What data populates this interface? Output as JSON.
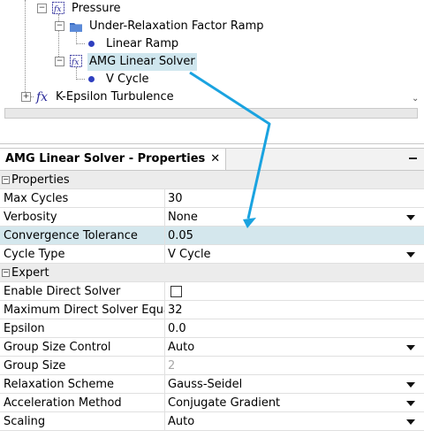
{
  "tree": {
    "nodes": [
      {
        "label": "Pressure",
        "icon": "fx-icon",
        "expander": "−"
      },
      {
        "label": "Under-Relaxation Factor Ramp",
        "icon": "folder-icon",
        "expander": "−"
      },
      {
        "label": "Linear Ramp",
        "icon": "bullet-icon"
      },
      {
        "label": "AMG Linear Solver",
        "icon": "fx-icon",
        "expander": "−",
        "selected": true
      },
      {
        "label": "V Cycle",
        "icon": "bullet-icon"
      },
      {
        "label": "K-Epsilon Turbulence",
        "icon": "fx-italic-icon",
        "expander": "+"
      }
    ]
  },
  "properties_view": {
    "tab_label": "AMG Linear Solver - Properties",
    "tab_close": "✕",
    "sections": [
      {
        "title": "Properties",
        "toggle": "−",
        "rows": [
          {
            "name": "Max Cycles",
            "value": "30"
          },
          {
            "name": "Verbosity",
            "value": "None",
            "dropdown": true
          },
          {
            "name": "Convergence Tolerance",
            "value": "0.05",
            "highlight": true
          },
          {
            "name": "Cycle Type",
            "value": "V Cycle",
            "dropdown": true
          }
        ]
      },
      {
        "title": "Expert",
        "toggle": "−",
        "rows": [
          {
            "name": "Enable Direct Solver",
            "value": "",
            "checkbox": true,
            "checked": false
          },
          {
            "name": "Maximum Direct Solver Equations",
            "value": "32"
          },
          {
            "name": "Epsilon",
            "value": "0.0"
          },
          {
            "name": "Group Size Control",
            "value": "Auto",
            "dropdown": true
          },
          {
            "name": "Group Size",
            "value": "2",
            "disabled": true
          },
          {
            "name": "Relaxation Scheme",
            "value": "Gauss-Seidel",
            "dropdown": true
          },
          {
            "name": "Acceleration Method",
            "value": "Conjugate Gradient",
            "dropdown": true
          },
          {
            "name": "Scaling",
            "value": "Auto",
            "dropdown": true
          }
        ]
      }
    ]
  },
  "colors": {
    "selection": "#cfe6ee",
    "highlight_row": "#d4e7ed",
    "annotation_arrow": "#1aa3e0",
    "bullet": "#2f3fbf"
  }
}
